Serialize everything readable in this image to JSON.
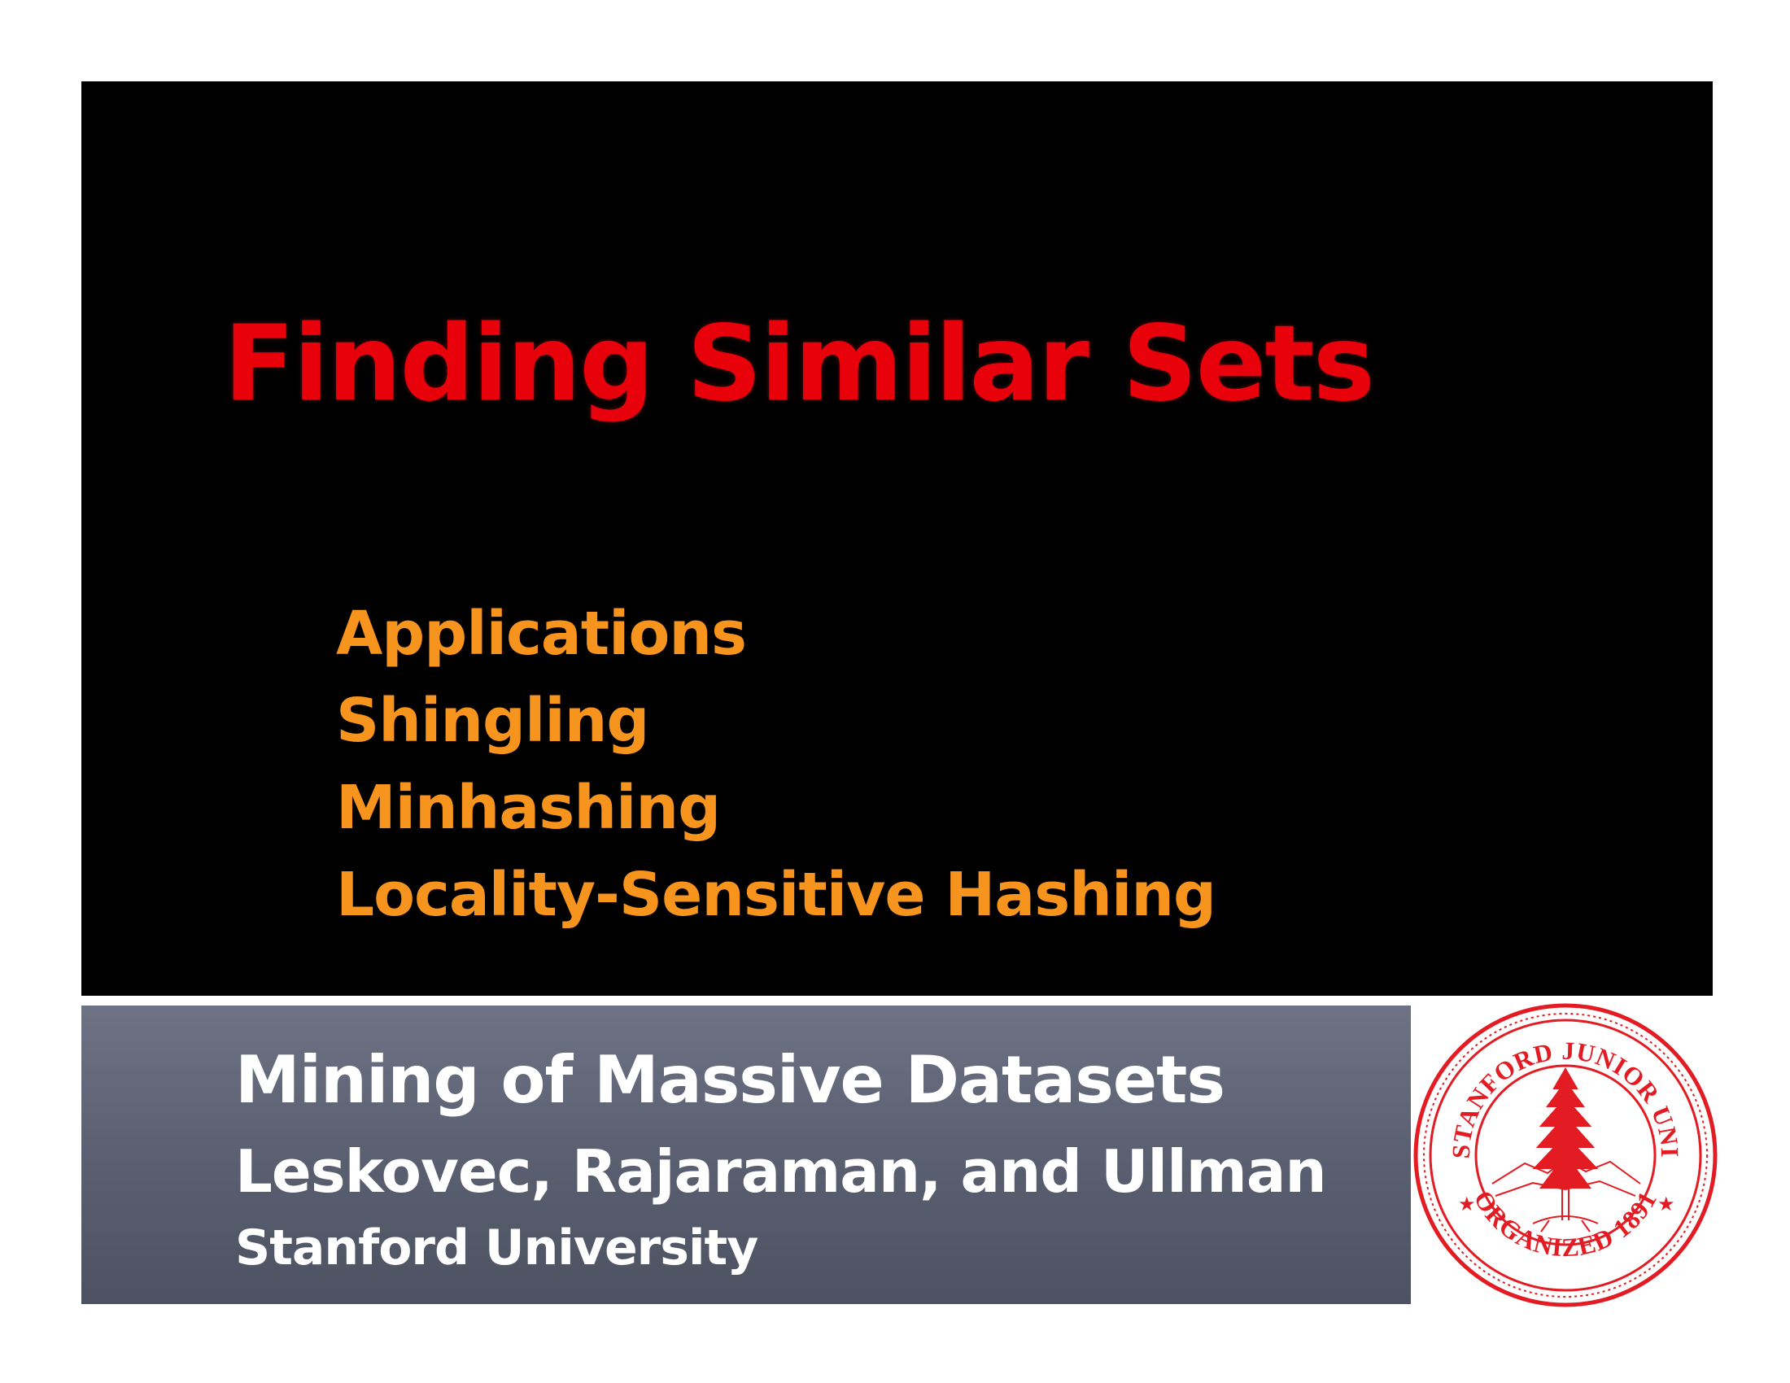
{
  "title": "Finding Similar Sets",
  "topics": [
    "Applications",
    "Shingling",
    "Minhashing",
    "Locality-Sensitive Hashing"
  ],
  "course": {
    "title": "Mining of Massive Datasets",
    "authors": "Leskovec, Rajaraman, and Ullman",
    "institution": "Stanford University"
  },
  "seal": {
    "top_text": "LELAND STANFORD JUNIOR UNIVERSITY",
    "bottom_text": "ORGANIZED 1891"
  },
  "colors": {
    "title": "#e8000b",
    "topics": "#f7941d",
    "top_panel": "#000000",
    "bottom_panel": "#5a6071",
    "seal": "#e31b23"
  }
}
